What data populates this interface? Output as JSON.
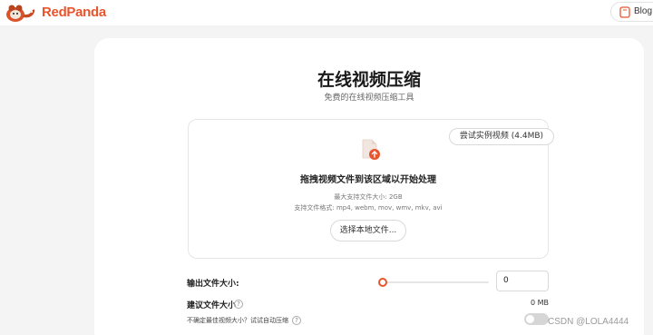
{
  "header": {
    "brand": "RedPanda",
    "blog_label": "Blog"
  },
  "main": {
    "title": "在线视频压缩",
    "subtitle": "免费的在线视频压缩工具"
  },
  "dropzone": {
    "sample_button": "尝试实例视频 (4.4MB)",
    "title": "拖拽视频文件到该区域以开始处理",
    "max_size": "最大支持文件大小: 2GB",
    "formats": "支持文件格式: mp4, webm, mov, wmv, mkv, avi",
    "choose_button": "选择本地文件..."
  },
  "settings": {
    "output_size_label": "输出文件大小:",
    "output_size_value": "0",
    "slider_fraction": 0,
    "suggested_label": "建议文件大小",
    "suggested_value": "0 MB",
    "auto_compress_text": "不确定最佳视频大小？试试自动压缩",
    "auto_compress_enabled": false
  },
  "watermark": "CSDN @LOLA4444",
  "colors": {
    "accent": "#e8552d",
    "background": "#f4f4f4"
  },
  "icons": [
    "red-panda-logo",
    "blog-icon",
    "upload-file-icon",
    "help-icon"
  ]
}
